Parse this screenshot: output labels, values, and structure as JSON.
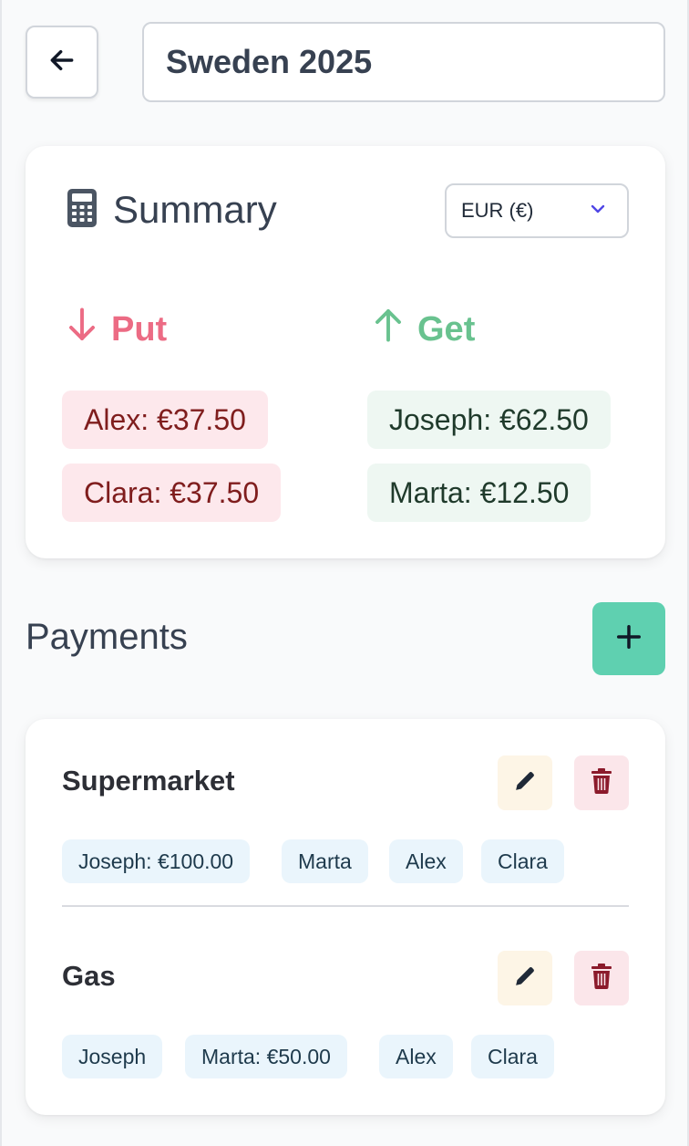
{
  "header": {
    "back_icon": "arrow-left-icon",
    "trip_name": "Sweden 2025"
  },
  "summary": {
    "icon": "calculator-icon",
    "title": "Summary",
    "currency": "EUR (€)",
    "put": {
      "label": "Put",
      "color": "#ec6b84",
      "entries": [
        "Alex: €37.50",
        "Clara: €37.50"
      ]
    },
    "get": {
      "label": "Get",
      "color": "#69c28f",
      "entries": [
        "Joseph: €62.50",
        "Marta: €12.50"
      ]
    }
  },
  "payments": {
    "title": "Payments",
    "add_icon": "plus-icon",
    "accent": "#5fd0b0",
    "items": [
      {
        "name": "Supermarket",
        "participants": [
          "Joseph: €100.00",
          "Marta",
          "Alex",
          "Clara"
        ]
      },
      {
        "name": "Gas",
        "participants": [
          "Joseph",
          "Marta: €50.00",
          "Alex",
          "Clara"
        ]
      }
    ]
  }
}
